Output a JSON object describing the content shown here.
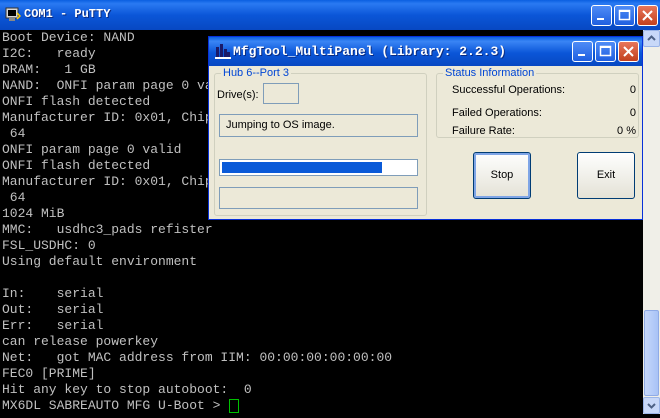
{
  "putty": {
    "title": "COM1 - PuTTY",
    "lines": [
      "Boot Device: NAND",
      "I2C:   ready",
      "DRAM:   1 GB",
      "NAND:  ONFI param page 0 valid",
      "ONFI flash detected",
      "Manufacturer ID: 0x01, Chip ID: 0xD3 (AMD/Spansion S34ML08G1), 1024MiB, page size: 2048, OOB size:",
      " 64",
      "ONFI param page 0 valid",
      "ONFI flash detected",
      "Manufacturer ID: 0x01, Chip ID: 0xD3 (AMD/Spansion S34ML08G1), 1024MiB, page size: 2048, OOB size:",
      " 64",
      "1024 MiB",
      "MMC:   usdhc3_pads refister",
      "FSL_USDHC: 0",
      "Using default environment",
      "",
      "In:    serial",
      "Out:   serial",
      "Err:   serial",
      "can release powerkey",
      "Net:   got MAC address from IIM: 00:00:00:00:00:00",
      "FEC0 [PRIME]",
      "Hit any key to stop autoboot:  0"
    ],
    "prompt": "MX6DL SABREAUTO MFG U-Boot > "
  },
  "mfgtool": {
    "title": "MfgTool_MultiPanel (Library: 2.2.3)",
    "hub_label": "Hub 6--Port 3",
    "drives_label": "Drive(s):",
    "drives_value": "",
    "status_text": "Jumping to OS image.",
    "progress_fraction": 0.83,
    "status_info": {
      "title": "Status Information",
      "successful_label": "Successful Operations:",
      "successful_value": "0",
      "failed_label": "Failed Operations:",
      "failed_value": "0",
      "failure_rate_label": "Failure Rate:",
      "failure_rate_value": "0 %"
    },
    "stop_label": "Stop",
    "exit_label": "Exit"
  },
  "colors": {
    "terminal_text": "#c0c0c0",
    "progress": "#0a5ad8",
    "group_title": "#0046d5"
  }
}
